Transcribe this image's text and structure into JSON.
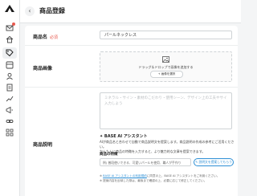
{
  "header": {
    "back_icon": "chevron-left-icon",
    "title": "商品登録"
  },
  "sidebar": {
    "logo": "base-logo-icon",
    "items": [
      {
        "icon": "mail-icon",
        "badge": true
      },
      {
        "icon": "home-icon"
      },
      {
        "icon": "tag-icon",
        "active": true
      },
      {
        "icon": "design-icon"
      },
      {
        "icon": "user-icon"
      },
      {
        "icon": "document-icon"
      },
      {
        "icon": "chart-icon"
      },
      {
        "icon": "megaphone-icon"
      },
      {
        "icon": "link-icon"
      },
      {
        "icon": "grid-icon"
      }
    ]
  },
  "form": {
    "name": {
      "label": "商品名",
      "required": "必須",
      "value": "パールネックレス"
    },
    "image": {
      "label": "商品画像",
      "drop_text": "ドラッグ＆ドロップで画像を追加する",
      "select_button": "+ 画像を選択"
    },
    "description": {
      "label": "商品説明",
      "placeholder_line1": "ミネラル・サイン・素材のこだわり・使用シーン、デザイン上の工夫やサイズ感などを",
      "placeholder_line2": "入力しよう",
      "ai_title": "✦ BASE AI アシスタント",
      "ai_desc_line1": "AIが商品名と合わせて自動で商品説明文を提案します。商品説明の作成の参考にご活用ください。",
      "ai_desc_line2": "かんたんに商品の特徴を入力すると、より魅力的な文章を提案できます。",
      "keywords_label": "商品の特徴",
      "keywords_placeholder": "例) 普段使いできる、可愛いパールを使用、職人が手作り",
      "generate_button": "✎ 説明文を提案してもらう",
      "note1_prefix": "※ ",
      "note1_link": "BASE AI アシスタントの利用規約",
      "note1_suffix": "に同意の上、BASE AI アシスタントをご利用ください。",
      "note2": "※ 提案内容を反映した際は、最後まで確認の上、必要に応じて修正してください。"
    }
  }
}
